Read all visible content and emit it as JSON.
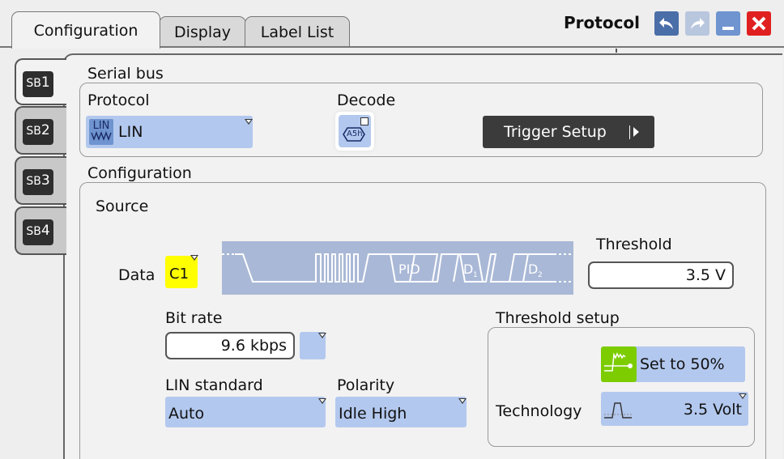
{
  "header": {
    "tabs": [
      {
        "label": "Configuration"
      },
      {
        "label": "Display"
      },
      {
        "label": "Label List"
      }
    ],
    "title": "Protocol"
  },
  "side_tabs": [
    {
      "label": "SB",
      "num": "1"
    },
    {
      "label": "SB",
      "num": "2"
    },
    {
      "label": "SB",
      "num": "3"
    },
    {
      "label": "SB",
      "num": "4"
    }
  ],
  "serial_bus": {
    "group_label": "Serial bus",
    "protocol_label": "Protocol",
    "protocol_value": "LIN",
    "protocol_icon_text": "LIN",
    "decode_label": "Decode",
    "decode_icon_text": "A5h",
    "trigger_setup_label": "Trigger Setup"
  },
  "configuration": {
    "group_label": "Configuration",
    "source_label": "Source",
    "data_label": "Data",
    "data_channel": "C1",
    "waveform_labels": {
      "pid": "PID",
      "d1": "D",
      "d1_sub": "1",
      "d2": "D",
      "d2_sub": "2"
    },
    "threshold_label": "Threshold",
    "threshold_value": "3.5 V",
    "bit_rate_label": "Bit rate",
    "bit_rate_value": "9.6 kbps",
    "lin_standard_label": "LIN standard",
    "lin_standard_value": "Auto",
    "polarity_label": "Polarity",
    "polarity_value": "Idle High",
    "threshold_setup": {
      "group_label": "Threshold setup",
      "set50_label": "Set to 50%",
      "technology_label": "Technology",
      "technology_value": "3.5 Volt"
    }
  },
  "colors": {
    "accent_blue": "#b3c8ee",
    "channel_yellow": "#ffff00",
    "close_red": "#e02020",
    "dark_button": "#3b3b3b",
    "set50_green": "#7ccc00"
  }
}
